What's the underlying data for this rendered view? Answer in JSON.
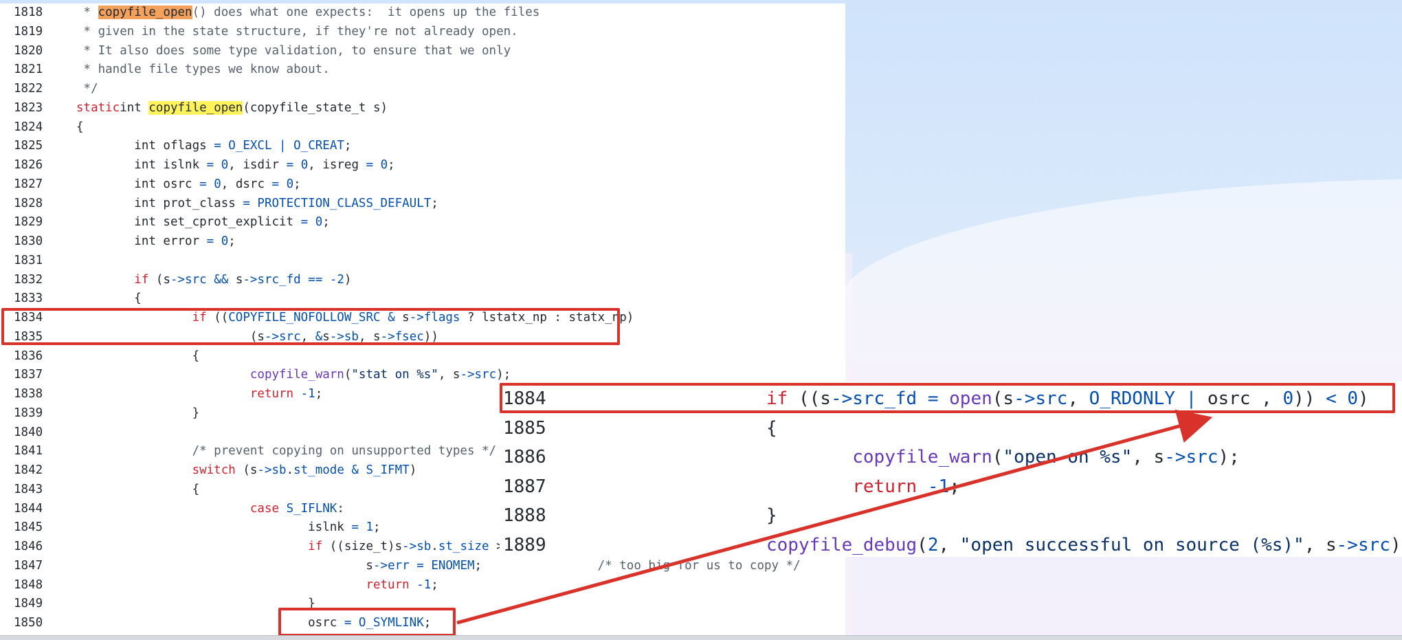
{
  "main_panel": {
    "lines": [
      {
        "n": "1818",
        "segs": [
          [
            "cmt",
            " * "
          ],
          [
            "hl-orange",
            "copyfile_open"
          ],
          [
            "cmt",
            "() does what one expects:  it opens up the files"
          ]
        ]
      },
      {
        "n": "1819",
        "segs": [
          [
            "cmt",
            " * given in the state structure, if they're not already open."
          ]
        ]
      },
      {
        "n": "1820",
        "segs": [
          [
            "cmt",
            " * It also does some type validation, to ensure that we only"
          ]
        ]
      },
      {
        "n": "1821",
        "segs": [
          [
            "cmt",
            " * handle file types we know about."
          ]
        ]
      },
      {
        "n": "1822",
        "segs": [
          [
            "cmt",
            " */"
          ]
        ]
      },
      {
        "n": "1823",
        "segs": [
          [
            "kw",
            "static"
          ],
          [
            "",
            "int "
          ],
          [
            "hl-yellow",
            "copyfile_open"
          ],
          [
            "",
            "(copyfile_state_t s)"
          ]
        ]
      },
      {
        "n": "1824",
        "segs": [
          [
            "",
            "{"
          ]
        ]
      },
      {
        "n": "1825",
        "segs": [
          [
            "",
            "        int oflags "
          ],
          [
            "op",
            "="
          ],
          [
            "",
            " "
          ],
          [
            "con",
            "O_EXCL"
          ],
          [
            "",
            " "
          ],
          [
            "op",
            "|"
          ],
          [
            "",
            " "
          ],
          [
            "con",
            "O_CREAT"
          ],
          [
            "",
            ";"
          ]
        ]
      },
      {
        "n": "1826",
        "segs": [
          [
            "",
            "        int islnk "
          ],
          [
            "op",
            "="
          ],
          [
            "",
            " "
          ],
          [
            "num",
            "0"
          ],
          [
            "",
            ", isdir "
          ],
          [
            "op",
            "="
          ],
          [
            "",
            " "
          ],
          [
            "num",
            "0"
          ],
          [
            "",
            ", isreg "
          ],
          [
            "op",
            "="
          ],
          [
            "",
            " "
          ],
          [
            "num",
            "0"
          ],
          [
            "",
            ";"
          ]
        ]
      },
      {
        "n": "1827",
        "segs": [
          [
            "",
            "        int osrc "
          ],
          [
            "op",
            "="
          ],
          [
            "",
            " "
          ],
          [
            "num",
            "0"
          ],
          [
            "",
            ", dsrc "
          ],
          [
            "op",
            "="
          ],
          [
            "",
            " "
          ],
          [
            "num",
            "0"
          ],
          [
            "",
            ";"
          ]
        ]
      },
      {
        "n": "1828",
        "segs": [
          [
            "",
            "        int prot_class "
          ],
          [
            "op",
            "="
          ],
          [
            "",
            " "
          ],
          [
            "con",
            "PROTECTION_CLASS_DEFAULT"
          ],
          [
            "",
            ";"
          ]
        ]
      },
      {
        "n": "1829",
        "segs": [
          [
            "",
            "        int set_cprot_explicit "
          ],
          [
            "op",
            "="
          ],
          [
            "",
            " "
          ],
          [
            "num",
            "0"
          ],
          [
            "",
            ";"
          ]
        ]
      },
      {
        "n": "1830",
        "segs": [
          [
            "",
            "        int error "
          ],
          [
            "op",
            "="
          ],
          [
            "",
            " "
          ],
          [
            "num",
            "0"
          ],
          [
            "",
            ";"
          ]
        ]
      },
      {
        "n": "1831",
        "segs": [
          [
            "",
            ""
          ]
        ]
      },
      {
        "n": "1832",
        "segs": [
          [
            "",
            "        "
          ],
          [
            "kw",
            "if"
          ],
          [
            "",
            " (s"
          ],
          [
            "op",
            "->"
          ],
          [
            "con",
            "src"
          ],
          [
            "",
            " "
          ],
          [
            "op",
            "&&"
          ],
          [
            "",
            " s"
          ],
          [
            "op",
            "->"
          ],
          [
            "con",
            "src_fd"
          ],
          [
            "",
            " "
          ],
          [
            "op",
            "=="
          ],
          [
            "",
            " "
          ],
          [
            "num",
            "-2"
          ],
          [
            "",
            ")"
          ]
        ]
      },
      {
        "n": "1833",
        "segs": [
          [
            "",
            "        {"
          ]
        ]
      },
      {
        "n": "1834",
        "segs": [
          [
            "",
            "                "
          ],
          [
            "kw",
            "if"
          ],
          [
            "",
            " (("
          ],
          [
            "con",
            "COPYFILE_NOFOLLOW_SRC"
          ],
          [
            "",
            " "
          ],
          [
            "op",
            "&"
          ],
          [
            "",
            " s"
          ],
          [
            "op",
            "->"
          ],
          [
            "con",
            "flags"
          ],
          [
            "",
            " ? lstatx_np : statx_np)"
          ]
        ]
      },
      {
        "n": "1835",
        "segs": [
          [
            "",
            "                        (s"
          ],
          [
            "op",
            "->"
          ],
          [
            "con",
            "src"
          ],
          [
            "",
            ", "
          ],
          [
            "op",
            "&"
          ],
          [
            "",
            "s"
          ],
          [
            "op",
            "->"
          ],
          [
            "con",
            "sb"
          ],
          [
            "",
            ", s"
          ],
          [
            "op",
            "->"
          ],
          [
            "con",
            "fsec"
          ],
          [
            "",
            "))"
          ]
        ]
      },
      {
        "n": "1836",
        "segs": [
          [
            "",
            "                {"
          ]
        ]
      },
      {
        "n": "1837",
        "segs": [
          [
            "",
            "                        "
          ],
          [
            "fn",
            "copyfile_warn"
          ],
          [
            "",
            "("
          ],
          [
            "str",
            "\"stat on %s\""
          ],
          [
            "",
            ", s"
          ],
          [
            "op",
            "->"
          ],
          [
            "con",
            "src"
          ],
          [
            "",
            ");"
          ]
        ]
      },
      {
        "n": "1838",
        "segs": [
          [
            "",
            "                        "
          ],
          [
            "kw",
            "return"
          ],
          [
            "",
            " "
          ],
          [
            "num",
            "-1"
          ],
          [
            "",
            ";"
          ]
        ]
      },
      {
        "n": "1839",
        "segs": [
          [
            "",
            "                }"
          ]
        ]
      },
      {
        "n": "1840",
        "segs": [
          [
            "",
            ""
          ]
        ]
      },
      {
        "n": "1841",
        "segs": [
          [
            "",
            "                "
          ],
          [
            "cmt",
            "/* prevent copying on unsupported types */"
          ]
        ]
      },
      {
        "n": "1842",
        "segs": [
          [
            "",
            "                "
          ],
          [
            "kw",
            "switch"
          ],
          [
            "",
            " (s"
          ],
          [
            "op",
            "->"
          ],
          [
            "con",
            "sb"
          ],
          [
            "",
            "."
          ],
          [
            "con",
            "st_mode"
          ],
          [
            "",
            " "
          ],
          [
            "op",
            "&"
          ],
          [
            "",
            " "
          ],
          [
            "con",
            "S_IFMT"
          ],
          [
            "",
            ")"
          ]
        ]
      },
      {
        "n": "1843",
        "segs": [
          [
            "",
            "                {"
          ]
        ]
      },
      {
        "n": "1844",
        "segs": [
          [
            "",
            "                        "
          ],
          [
            "kw",
            "case"
          ],
          [
            "",
            " "
          ],
          [
            "con",
            "S_IFLNK"
          ],
          [
            "",
            ":"
          ]
        ]
      },
      {
        "n": "1845",
        "segs": [
          [
            "",
            "                                islnk "
          ],
          [
            "op",
            "="
          ],
          [
            "",
            " "
          ],
          [
            "num",
            "1"
          ],
          [
            "",
            ";"
          ]
        ]
      },
      {
        "n": "1846",
        "segs": [
          [
            "",
            "                                "
          ],
          [
            "kw",
            "if"
          ],
          [
            "",
            " ((size_t)s"
          ],
          [
            "op",
            "->"
          ],
          [
            "con",
            "sb"
          ],
          [
            "",
            "."
          ],
          [
            "con",
            "st_size"
          ],
          [
            "",
            " >"
          ]
        ]
      },
      {
        "n": "1847",
        "segs": [
          [
            "",
            "                                        s"
          ],
          [
            "op",
            "->"
          ],
          [
            "con",
            "err"
          ],
          [
            "",
            " "
          ],
          [
            "op",
            "="
          ],
          [
            "",
            " "
          ],
          [
            "con",
            "ENOMEM"
          ],
          [
            "",
            ";"
          ],
          [
            "",
            "                "
          ],
          [
            "cmt",
            "/* too big for us to copy */"
          ]
        ]
      },
      {
        "n": "1848",
        "segs": [
          [
            "",
            "                                        "
          ],
          [
            "kw",
            "return"
          ],
          [
            "",
            " "
          ],
          [
            "num",
            "-1"
          ],
          [
            "",
            ";"
          ]
        ]
      },
      {
        "n": "1849",
        "segs": [
          [
            "",
            "                                }"
          ]
        ]
      },
      {
        "n": "1850",
        "segs": [
          [
            "",
            "                                osrc "
          ],
          [
            "op",
            "="
          ],
          [
            "",
            " "
          ],
          [
            "con",
            "O_SYMLINK"
          ],
          [
            "",
            ";"
          ]
        ]
      }
    ]
  },
  "zoom_panel": {
    "lines": [
      {
        "n": "1884",
        "segs": [
          [
            "kw",
            "if"
          ],
          [
            "",
            " ((s"
          ],
          [
            "op",
            "->"
          ],
          [
            "con",
            "src_fd"
          ],
          [
            "",
            " "
          ],
          [
            "op",
            "="
          ],
          [
            "",
            " "
          ],
          [
            "fn",
            "open"
          ],
          [
            "",
            "(s"
          ],
          [
            "op",
            "->"
          ],
          [
            "con",
            "src"
          ],
          [
            "",
            ", "
          ],
          [
            "con",
            "O_RDONLY"
          ],
          [
            "",
            " "
          ],
          [
            "op",
            "|"
          ],
          [
            "",
            " osrc , "
          ],
          [
            "num",
            "0"
          ],
          [
            "",
            "))"
          ],
          [
            "",
            " "
          ],
          [
            "op",
            "<"
          ],
          [
            "",
            " "
          ],
          [
            "num",
            "0"
          ],
          [
            "",
            ")"
          ]
        ]
      },
      {
        "n": "1885",
        "segs": [
          [
            "",
            "{"
          ]
        ]
      },
      {
        "n": "1886",
        "segs": [
          [
            "",
            "        "
          ],
          [
            "fn",
            "copyfile_warn"
          ],
          [
            "",
            "("
          ],
          [
            "str",
            "\"open on %s\""
          ],
          [
            "",
            ", s"
          ],
          [
            "op",
            "->"
          ],
          [
            "con",
            "src"
          ],
          [
            "",
            ");"
          ]
        ]
      },
      {
        "n": "1887",
        "segs": [
          [
            "",
            "        "
          ],
          [
            "kw",
            "return"
          ],
          [
            "",
            " "
          ],
          [
            "num",
            "-1"
          ],
          [
            "",
            ";"
          ]
        ]
      },
      {
        "n": "1888",
        "segs": [
          [
            "",
            "}"
          ]
        ]
      },
      {
        "n": "1889",
        "segs": [
          [
            "fn",
            "copyfile_debug"
          ],
          [
            "",
            "("
          ],
          [
            "num",
            "2"
          ],
          [
            "",
            ", "
          ],
          [
            "str",
            "\"open successful on source (%s)\""
          ],
          [
            "",
            ", s"
          ],
          [
            "op",
            "->"
          ],
          [
            "con",
            "src"
          ],
          [
            "",
            ");"
          ]
        ]
      }
    ]
  },
  "annotation_color": "#d9322a"
}
